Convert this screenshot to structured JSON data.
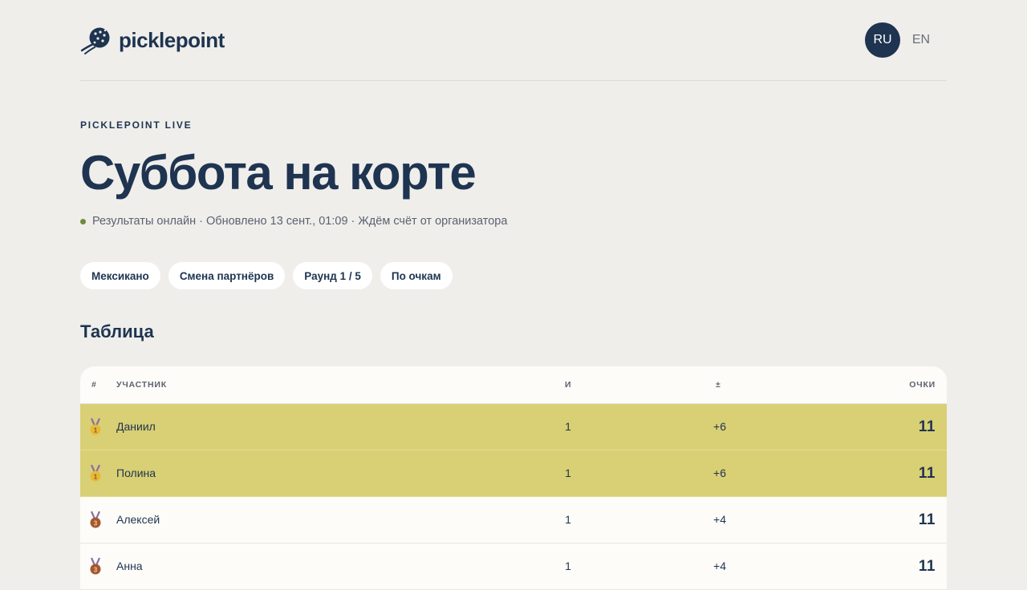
{
  "header": {
    "brand": "picklepoint",
    "lang_active": "RU",
    "lang_other": "EN"
  },
  "hero": {
    "eyebrow": "PICKLEPOINT LIVE",
    "title": "Суббота на корте",
    "status": "Результаты онлайн · Обновлено 13 сент., 01:09 · Ждём счёт от организатора"
  },
  "chips": [
    "Мексикано",
    "Смена партнёров",
    "Раунд 1 / 5",
    "По очкам"
  ],
  "table": {
    "section_title": "Таблица",
    "headers": {
      "rank": "#",
      "name": "УЧАСТНИК",
      "games": "И",
      "diff": "±",
      "points": "ОЧКИ"
    },
    "rows": [
      {
        "medal": "gold-medal-icon",
        "name": "Даниил",
        "games": "1",
        "diff": "+6",
        "points": "11",
        "highlight": true
      },
      {
        "medal": "gold-medal-icon",
        "name": "Полина",
        "games": "1",
        "diff": "+6",
        "points": "11",
        "highlight": true
      },
      {
        "medal": "bronze-medal-icon",
        "name": "Алексей",
        "games": "1",
        "diff": "+4",
        "points": "11",
        "highlight": false
      },
      {
        "medal": "bronze-medal-icon",
        "name": "Анна",
        "games": "1",
        "diff": "+4",
        "points": "11",
        "highlight": false
      }
    ]
  },
  "colors": {
    "navy": "#1e3450",
    "background": "#efeeeb",
    "highlight_row": "#d9cf74",
    "gold": "#e7b93a",
    "bronze": "#a5582f",
    "status_dot": "#6f8a3b"
  }
}
